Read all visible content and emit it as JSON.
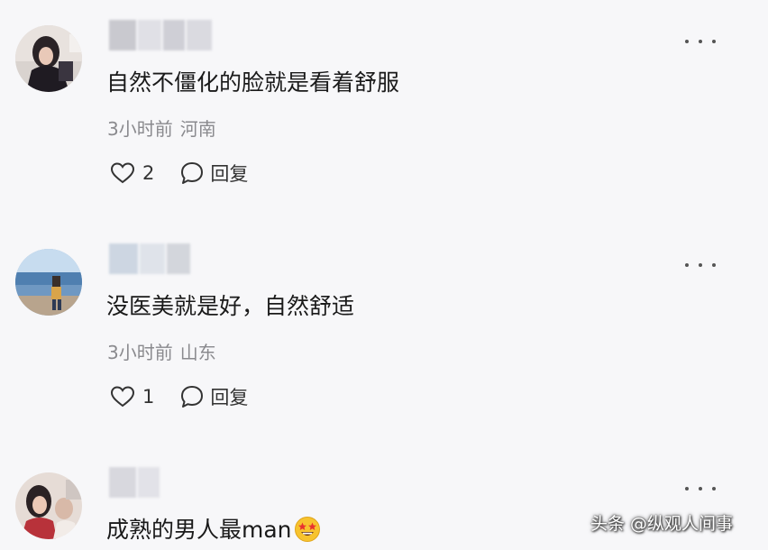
{
  "comments": [
    {
      "text": "自然不僵化的脸就是看着舒服",
      "time": "3小时前",
      "location": "河南",
      "likes": "2",
      "reply_label": "回复"
    },
    {
      "text": "没医美就是好，自然舒适",
      "time": "3小时前",
      "location": "山东",
      "likes": "1",
      "reply_label": "回复"
    },
    {
      "text": "成熟的男人最man"
    }
  ],
  "watermark": "头条 @纵观人间事",
  "icons": {
    "more": "more-dots-icon",
    "like": "heart-icon",
    "reply": "chat-bubble-icon",
    "emoji": "star-struck-emoji-icon"
  },
  "colors": {
    "background": "#f7f7f9",
    "meta_text": "#8a8a8e",
    "body_text": "#1a1a1a"
  }
}
